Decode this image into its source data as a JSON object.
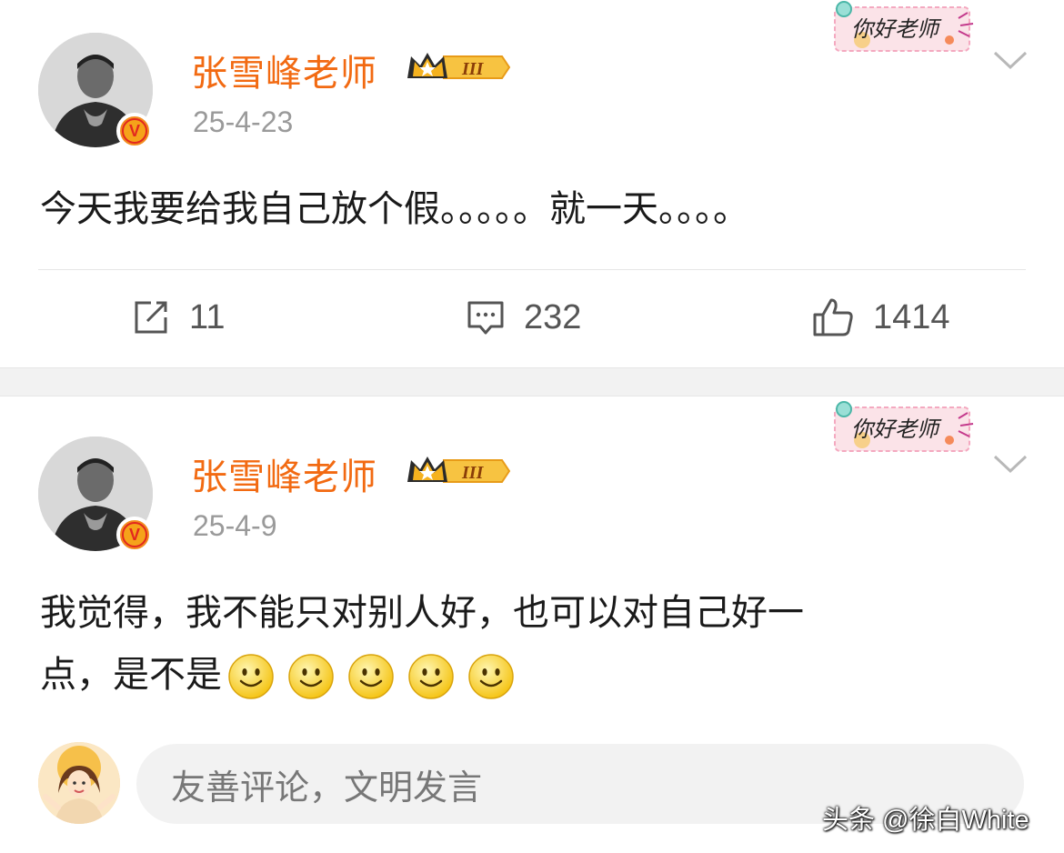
{
  "posts": [
    {
      "username": "张雪峰老师",
      "level_badge": "III",
      "sticker_text": "你好老师",
      "timestamp": "25-4-23",
      "text": "今天我要给我自己放个假。。。。。就一天。。。。",
      "repost_count": "11",
      "comment_count": "232",
      "like_count": "1414"
    },
    {
      "username": "张雪峰老师",
      "level_badge": "III",
      "sticker_text": "你好老师",
      "timestamp": "25-4-9",
      "line1": "我觉得，我不能只对别人好，也可以对自己好一",
      "line2": "点，是不是",
      "emoji": [
        "smile",
        "smile",
        "smile",
        "smile",
        "smile"
      ]
    }
  ],
  "comment_bar": {
    "placeholder": "友善评论，文明发言"
  },
  "watermark": "头条 @徐白White",
  "colors": {
    "username": "#f26a12",
    "timestamp": "#9a9a9a",
    "verified": "#f28c1e",
    "divider": "#f2f2f2"
  }
}
